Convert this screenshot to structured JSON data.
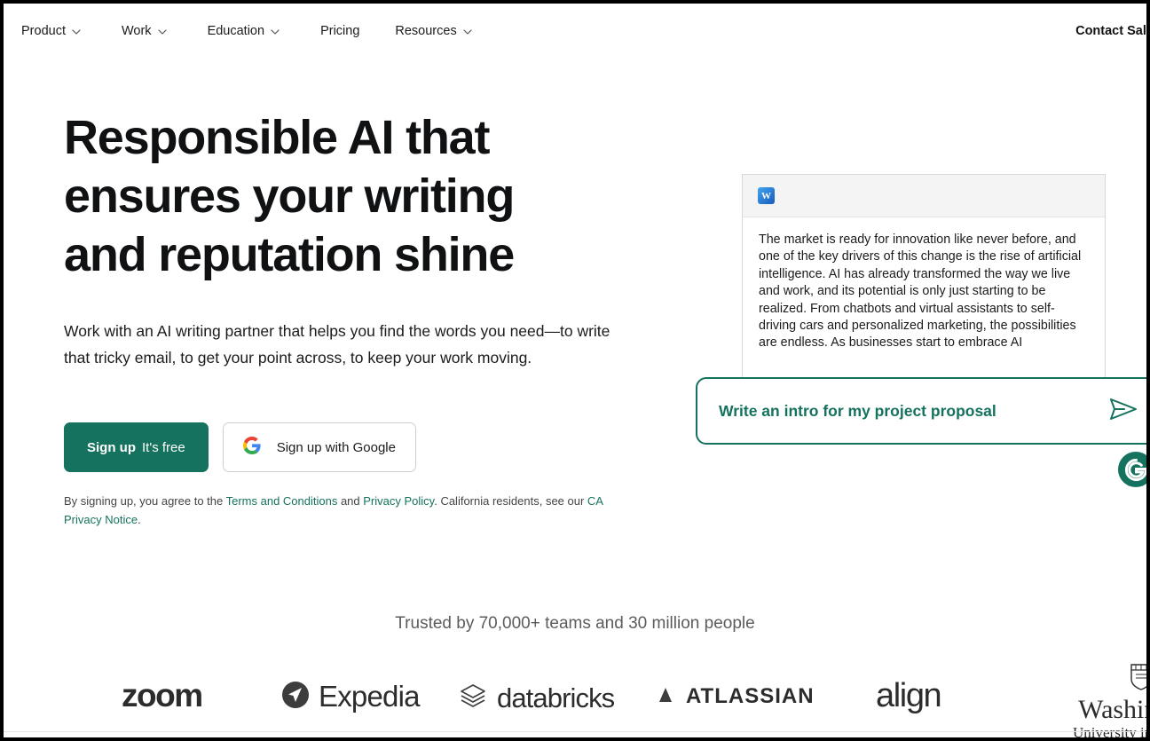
{
  "nav": {
    "items": [
      {
        "label": "Product",
        "has_caret": true,
        "icon": "chevron-down-icon"
      },
      {
        "label": "Work",
        "has_caret": true,
        "icon": "chevron-down-icon"
      },
      {
        "label": "Education",
        "has_caret": true,
        "icon": "chevron-down-icon"
      },
      {
        "label": "Pricing",
        "has_caret": false,
        "icon": ""
      },
      {
        "label": "Resources",
        "has_caret": true,
        "icon": "chevron-down-icon"
      }
    ],
    "contact_sales": "Contact Sales"
  },
  "hero": {
    "headline_line1": "Responsible AI that",
    "headline_line2": "ensures your writing",
    "headline_line3": "and reputation shine",
    "subhead": "Work with an AI writing partner that helps you find the words you need—to write that tricky email, to get your point across, to keep your work moving.",
    "signup_bold": "Sign up",
    "signup_light": "It's free",
    "google_button": "Sign up with Google",
    "google_icon": "google-g-icon",
    "legal_prefix": "By signing up, you agree to the ",
    "legal_terms": "Terms and Conditions",
    "legal_and": " and ",
    "legal_privacy": "Privacy Policy",
    "legal_mid": ". California residents, see our ",
    "legal_ca": "CA Privacy Notice",
    "legal_suffix": "."
  },
  "doc_card": {
    "app_icon": "microsoft-word-icon",
    "app_icon_letter": "W",
    "body": "The market is ready for innovation like never before, and one of the key drivers of this change is the rise of artificial intelligence. AI has already transformed the way we live and work, and its potential is only just starting to be realized. From chatbots and virtual assistants to self-driving cars and personalized marketing, the possibilities are endless. As businesses start to embrace AI"
  },
  "prompt": {
    "text": "Write an intro for my project proposal",
    "send_icon": "send-paper-plane-icon"
  },
  "badge": {
    "name": "grammarly-g-icon",
    "letter": "G"
  },
  "trusted": {
    "text": "Trusted by 70,000+ teams and 30 million people"
  },
  "logos": [
    {
      "name": "zoom",
      "label": "zoom"
    },
    {
      "name": "expedia",
      "label": "Expedia"
    },
    {
      "name": "databricks",
      "label": "databricks"
    },
    {
      "name": "atlassian",
      "label": "ATLASSIAN"
    },
    {
      "name": "align",
      "label": "align"
    },
    {
      "name": "washington-university",
      "label": "Washington",
      "sub": "University in St. Louis"
    }
  ],
  "colors": {
    "brand_teal": "#15725e",
    "text_dark": "#101113",
    "muted": "#5c5c5c",
    "word_blue": "#185abd"
  }
}
